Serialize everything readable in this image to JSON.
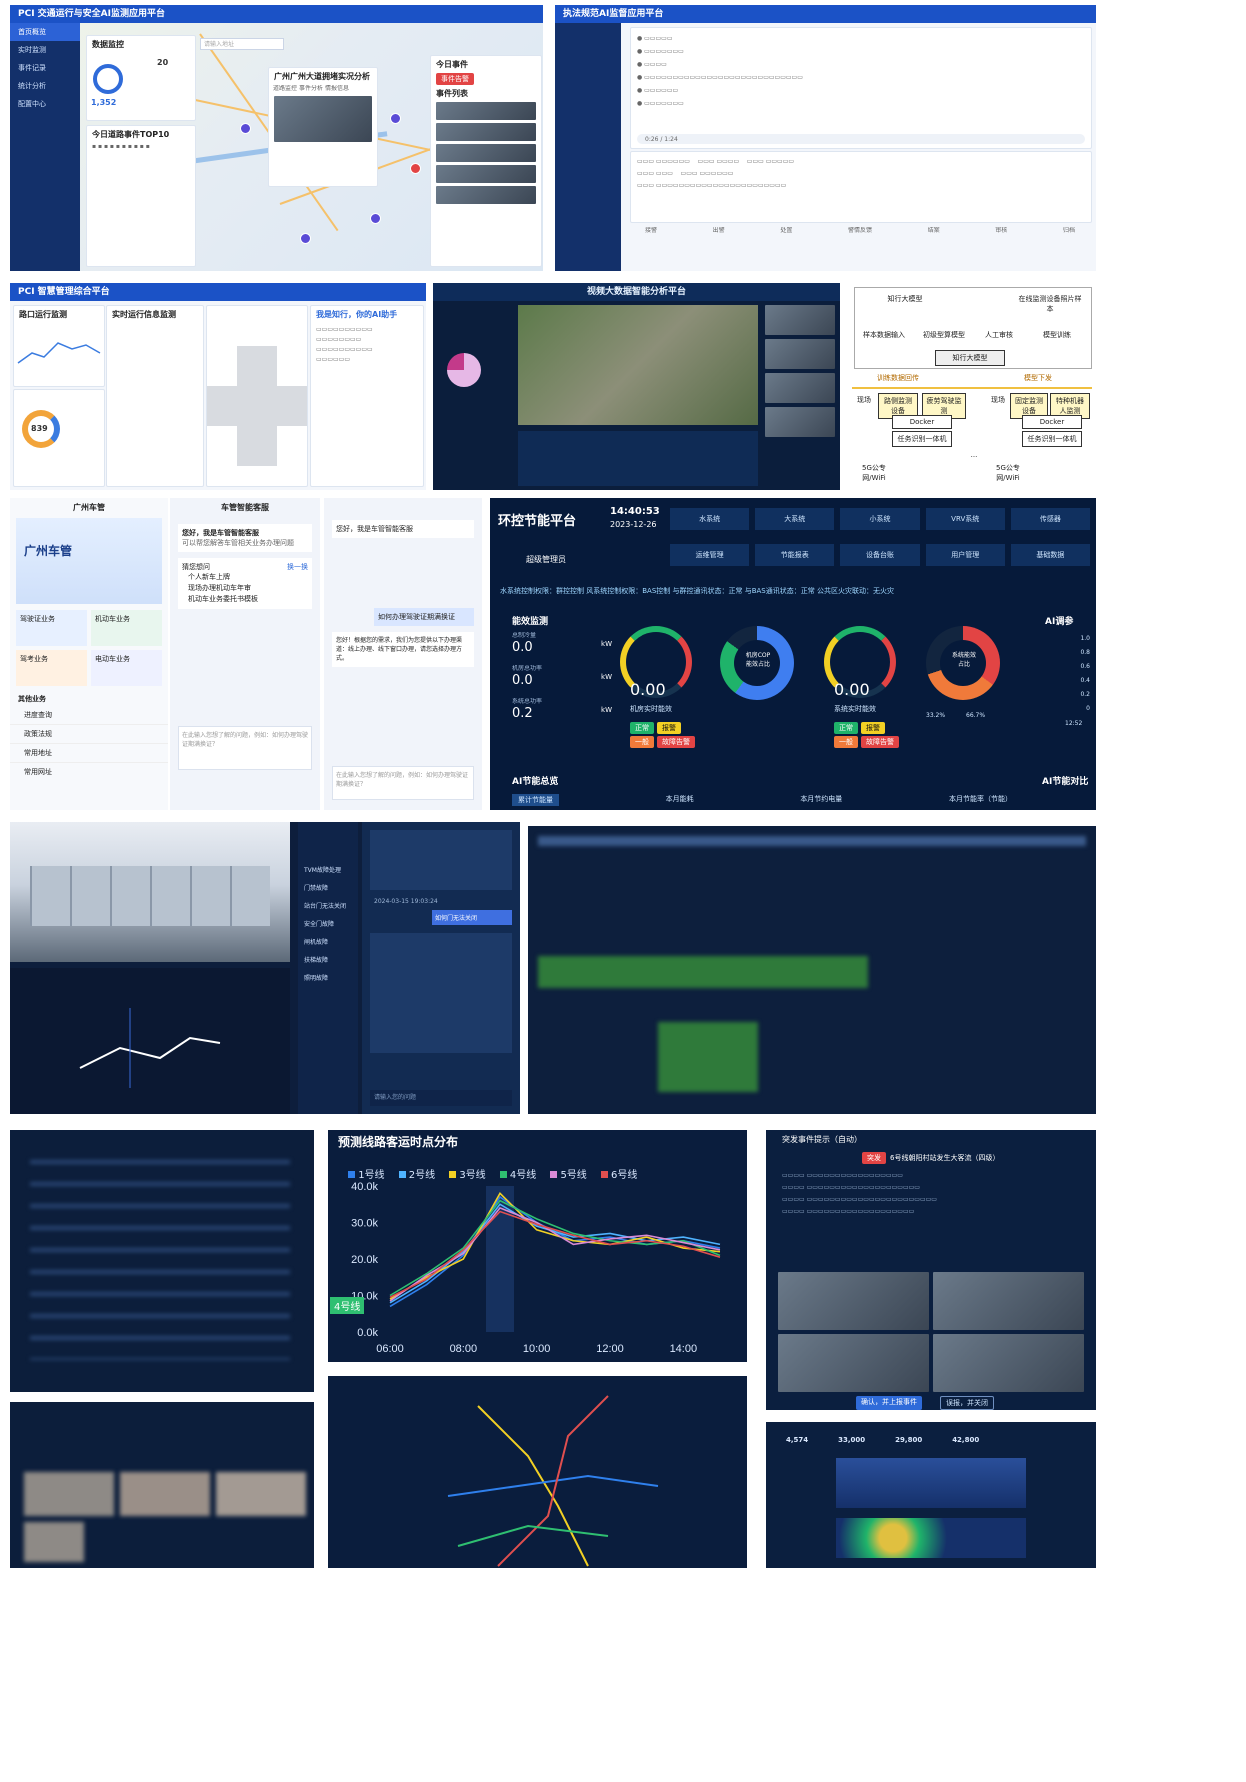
{
  "p1": {
    "title": "PCI 交通运行与安全AI监测应用平台",
    "search_placeholder": "请输入地址",
    "menu": [
      "首页概览",
      "实时监测",
      "事件记录",
      "统计分析",
      "配置中心"
    ],
    "overview_title": "数据监控",
    "stat_total": "1,352",
    "stat_a": "20",
    "top10_title": "今日道路事件TOP10",
    "popup_title": "广州广州大道拥堵实况分析",
    "popup_tabs": [
      "道路监控",
      "事件分析",
      "情报信息"
    ],
    "alert_title": "今日事件",
    "alert_status": "事件告警",
    "event_list_title": "事件列表"
  },
  "p2": {
    "title": "执法规范AI监督应用平台",
    "player_time": "0:26 / 1:24",
    "steps": [
      "接警",
      "出警",
      "处置",
      "警情反馈",
      "结案",
      "审核",
      "归档"
    ]
  },
  "p3": {
    "title": "PCI 智慧管理综合平台",
    "panel_a": "路口运行监测",
    "panel_b": "实时运行信息监测",
    "donut_value": "839",
    "assistant_title": "我是知行，你的AI助手"
  },
  "p4": {
    "title": "视频大数据智能分析平台"
  },
  "p5": {
    "left_label": "知行大模型",
    "right_label": "在线监测设备照片样本",
    "steps": [
      "样本数据输入",
      "初级型算模型",
      "人工审核",
      "模型训练"
    ],
    "center_box": "知行大模型",
    "left_tag": "训练数据回传",
    "right_tag": "模型下发",
    "col_labels": [
      "现场",
      "现场"
    ],
    "left_boxes": [
      "路侧监测设备",
      "疲劳驾驶监测",
      "Docker",
      "任务识别一体机"
    ],
    "right_boxes": [
      "固定监测设备",
      "特种机器人监测",
      "Docker",
      "任务识别一体机"
    ],
    "net_label": "5G公专网/WiFi",
    "dots": "..."
  },
  "p6": {
    "title1": "广州车管",
    "title2": "车管智能客服",
    "brand": "广州车管",
    "tiles": [
      "驾驶证业务",
      "机动车业务",
      "驾考业务",
      "电动车业务"
    ],
    "other_title": "其他业务",
    "other_items": [
      "进度查询",
      "政策法规",
      "常用地址",
      "常用网址"
    ],
    "greet": "您好，我是车管智能客服",
    "greet_sub": "可以帮您解答车管相关业务办理问题",
    "guess": "猜您想问",
    "change": "换一换",
    "guess_items": [
      "个人新车上牌",
      "现场办理机动车年审",
      "机动车业务委托书模板"
    ],
    "input_ph": "在此输入您想了解的问题，例如：如何办理驾驶证期满换证？",
    "user_q": "如何办理驾驶证期满换证",
    "answer": "您好！根据您的需求，我们为您提供以下办理渠道：线上办理、线下窗口办理，请您选择办理方式。"
  },
  "p7": {
    "title": "环控节能平台",
    "time": "14:40:53",
    "date": "2023-12-26",
    "user": "超级管理员",
    "tabs": [
      "水系统",
      "大系统",
      "小系统",
      "VRV系统",
      "传感器"
    ],
    "tabs2": [
      "运维管理",
      "节能报表",
      "设备台账",
      "用户管理",
      "基础数据"
    ],
    "status": "水系统控制权限：群控控制  风系统控制权限：BAS控制  与群控通讯状态：正常  与BAS通讯状态：正常  公共区火灾联动：无火灾",
    "eff_title": "能效监测",
    "metrics": [
      {
        "label": "总制冷量",
        "value": "0.0",
        "unit": "kW"
      },
      {
        "label": "机房总功率",
        "value": "0.0",
        "unit": "kW"
      },
      {
        "label": "系统总功率",
        "value": "0.2",
        "unit": "kW"
      }
    ],
    "gauge1_value": "0.00",
    "gauge1_label": "机房实时能效",
    "gauge2_label": "机房COP\n能效占比",
    "gauge3_value": "0.00",
    "gauge3_label": "系统实时能效",
    "gauge4_label": "系统能效\n占比",
    "pct1": "33.2%",
    "pct2": "66.7%",
    "ai_title": "AI调参",
    "ai_save": "AI节能总览",
    "ai_compare": "AI节能对比",
    "bottom_tabs": [
      "累计节能量",
      "本月能耗",
      "本月节约电量",
      "本月节能率（节能）"
    ],
    "y_ticks": [
      "1.0",
      "0.8",
      "0.6",
      "0.4",
      "0.2",
      "0"
    ],
    "x_tick": "12:52",
    "btn_labels": [
      "正常",
      "报警",
      "一般",
      "故障告警"
    ]
  },
  "p8": {
    "chat_time": "2024-03-15 19:03:24",
    "chat_q": "如何门无法关闭",
    "menu": [
      "TVM故障处理",
      "门禁故障",
      "站台门无法关闭",
      "安全门故障",
      "闸机故障",
      "扶梯故障",
      "照明故障"
    ],
    "input_ph": "请输入您的问题"
  },
  "p10": {
    "title": "预测线路客运时点分布",
    "legend": [
      "1号线",
      "2号线",
      "3号线",
      "4号线",
      "5号线",
      "6号线"
    ],
    "legend_colors": [
      "#2f80ed",
      "#4fb3ff",
      "#f2d024",
      "#2fbf71",
      "#d98ad6",
      "#e04f4f"
    ],
    "y_ticks": [
      "40.0k",
      "30.0k",
      "20.0k",
      "10.0k",
      "0.0k"
    ],
    "x_ticks": [
      "06:00",
      "08:00",
      "10:00",
      "12:00",
      "14:00"
    ],
    "tooltip": "4号线"
  },
  "p11": {
    "title": "突发事件提示（自动）",
    "badge": "突发",
    "event": "6号线朝阳村站发生大客流（四级）",
    "btn1": "确认，并上报事件",
    "btn2": "误报，并关闭"
  },
  "p12": {
    "stats": [
      "4,574",
      "33,000",
      "29,800",
      "42,800"
    ]
  },
  "chart_data": {
    "type": "line",
    "title": "预测线路客运时点分布",
    "x": [
      "06:00",
      "07:00",
      "08:00",
      "09:00",
      "10:00",
      "11:00",
      "12:00",
      "13:00",
      "14:00",
      "15:00"
    ],
    "ylim": [
      0,
      40000
    ],
    "series": [
      {
        "name": "1号线",
        "values": [
          7000,
          13000,
          21000,
          37000,
          30000,
          25000,
          26000,
          24000,
          25000,
          23000
        ]
      },
      {
        "name": "2号线",
        "values": [
          8000,
          14000,
          22000,
          35000,
          29000,
          26000,
          27000,
          25000,
          26000,
          24000
        ]
      },
      {
        "name": "3号线",
        "values": [
          9000,
          15000,
          20000,
          38000,
          28000,
          25000,
          24000,
          26000,
          23000,
          22000
        ]
      },
      {
        "name": "4号线",
        "values": [
          10000,
          16000,
          23000,
          36000,
          31000,
          27000,
          25000,
          24000,
          25000,
          21000
        ]
      },
      {
        "name": "5号线",
        "values": [
          8500,
          15500,
          21500,
          34000,
          30000,
          24000,
          25500,
          26500,
          24500,
          22500
        ]
      },
      {
        "name": "6号线",
        "values": [
          9500,
          14500,
          22500,
          33000,
          29500,
          26500,
          24000,
          25000,
          23500,
          20500
        ]
      }
    ]
  }
}
